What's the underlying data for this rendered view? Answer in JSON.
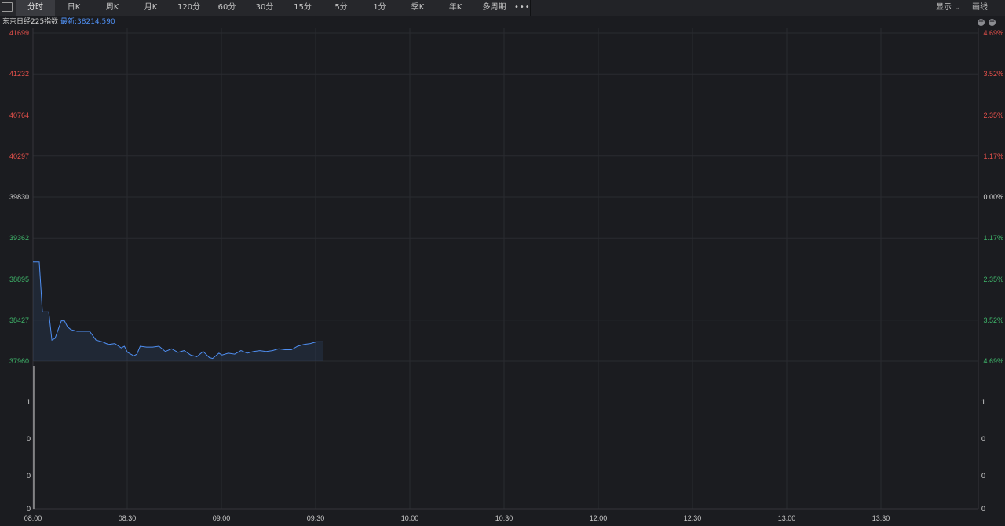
{
  "toolbar": {
    "tabs": [
      {
        "label": "分时",
        "active": true
      },
      {
        "label": "日K"
      },
      {
        "label": "周K"
      },
      {
        "label": "月K"
      },
      {
        "label": "120分"
      },
      {
        "label": "60分"
      },
      {
        "label": "30分"
      },
      {
        "label": "15分"
      },
      {
        "label": "5分"
      },
      {
        "label": "1分"
      },
      {
        "label": "季K"
      },
      {
        "label": "年K"
      },
      {
        "label": "多周期"
      }
    ],
    "more_label": "•••",
    "display_label": "显示",
    "draw_label": "画线"
  },
  "info": {
    "name": "东京日经225指数",
    "latest": "最新:38214.590"
  },
  "colors": {
    "up": "#e8514b",
    "flat": "#d8d8d8",
    "down": "#3fb56a",
    "line": "#4f8ff2",
    "grid": "#2a2b30"
  },
  "chart_data": {
    "type": "line",
    "price_axis": {
      "ticks": [
        "41699",
        "41232",
        "40764",
        "40297",
        "39830",
        "39362",
        "38895",
        "38427",
        "37960"
      ],
      "ylim": [
        37960,
        41699
      ]
    },
    "pct_axis": {
      "ticks": [
        "4.69%",
        "3.52%",
        "2.35%",
        "1.17%",
        "0.00%",
        "1.17%",
        "2.35%",
        "3.52%",
        "4.69%"
      ]
    },
    "volume_axis": {
      "ticks": [
        "1",
        "0",
        "0",
        "0"
      ],
      "right_ticks": [
        "1",
        "0",
        "0",
        "0"
      ]
    },
    "x_ticks": [
      "08:00",
      "08:30",
      "09:00",
      "09:30",
      "10:00",
      "10:30",
      "12:00",
      "12:30",
      "13:00",
      "13:30"
    ],
    "session_minutes": 300,
    "series": [
      {
        "minutes": [
          0,
          2,
          3,
          4,
          5,
          6,
          7,
          8,
          9,
          10,
          11,
          12,
          14,
          16,
          18,
          20,
          22,
          24,
          26,
          28,
          29,
          30,
          32,
          33,
          34,
          36,
          38,
          40,
          42,
          44,
          46,
          48,
          50,
          52,
          54,
          56,
          57,
          58,
          59,
          60,
          62,
          64,
          66,
          68,
          70,
          72,
          74,
          76,
          78,
          80,
          82,
          84,
          86,
          88,
          90,
          92
        ],
        "values": [
          39090,
          39090,
          38520,
          38520,
          38520,
          38200,
          38220,
          38320,
          38420,
          38420,
          38350,
          38320,
          38300,
          38300,
          38300,
          38200,
          38180,
          38150,
          38160,
          38110,
          38130,
          38060,
          38020,
          38040,
          38130,
          38120,
          38120,
          38130,
          38070,
          38100,
          38060,
          38080,
          38030,
          38010,
          38070,
          38000,
          37990,
          38020,
          38050,
          38030,
          38050,
          38040,
          38080,
          38050,
          38070,
          38080,
          38070,
          38080,
          38100,
          38090,
          38090,
          38130,
          38150,
          38160,
          38180,
          38180
        ]
      }
    ]
  }
}
